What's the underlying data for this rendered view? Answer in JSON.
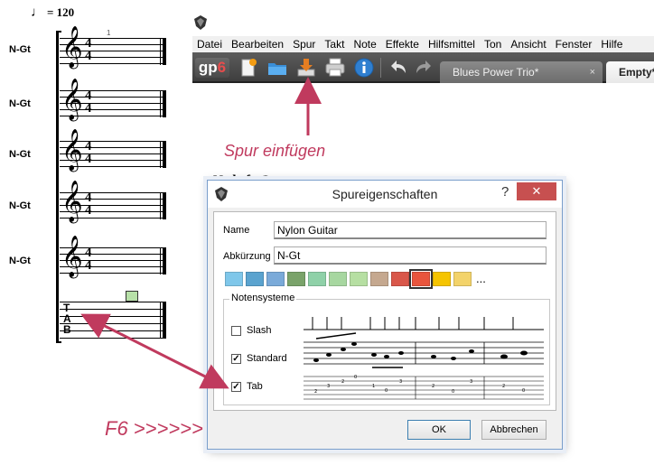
{
  "score": {
    "tempo": "= 120",
    "bar_number": "1",
    "track_labels": [
      "N-Gt",
      "N-Gt",
      "N-Gt",
      "N-Gt",
      "N-Gt"
    ],
    "time_signature_top": "4",
    "time_signature_bottom": "4",
    "tab_letters": [
      "T",
      "A",
      "B"
    ]
  },
  "menu": [
    "Datei",
    "Bearbeiten",
    "Spur",
    "Takt",
    "Note",
    "Effekte",
    "Hilfsmittel",
    "Ton",
    "Ansicht",
    "Fenster",
    "Hilfe"
  ],
  "toolbar": {
    "logo_prefix": "gp",
    "logo_version": "6",
    "tabs": [
      {
        "label": "Blues Power Trio*",
        "active": false,
        "close": "×"
      },
      {
        "label": "Empty*",
        "active": true
      }
    ]
  },
  "annotations": {
    "spur": "Spur einfügen",
    "f6": "F6 >>>>>>"
  },
  "doc_title_fragment": "N. l. f. G. t. ..",
  "dialog": {
    "title": "Spureigenschaften",
    "help": "?",
    "close": "✕",
    "name_label": "Name",
    "name_value": "Nylon Guitar",
    "abbr_label": "Abkürzung",
    "abbr_value": "N-Gt",
    "swatches": [
      "#7fc7ea",
      "#5aa3cf",
      "#7aaad9",
      "#7aa36a",
      "#8fd1a8",
      "#a7d7a0",
      "#b6dfa2",
      "#c5a88f",
      "#d9574a",
      "#e8553d",
      "#f5c400",
      "#f3d36a"
    ],
    "selected_swatch": 9,
    "more": "...",
    "group_title": "Notensysteme",
    "options": [
      {
        "label": "Slash",
        "checked": false,
        "mark": ""
      },
      {
        "label": "Standard",
        "checked": true,
        "mark": "✓"
      },
      {
        "label": "Tab",
        "checked": true,
        "mark": "✓"
      }
    ],
    "ok": "OK",
    "cancel": "Abbrechen"
  },
  "colors": {
    "annotation": "#c03a5e",
    "close_button": "#c75050",
    "toolbar": "#4a4a4a"
  },
  "icons": [
    "app-icon",
    "new-document-icon",
    "open-folder-icon",
    "insert-track-icon",
    "print-icon",
    "info-icon",
    "undo-icon",
    "redo-icon"
  ]
}
